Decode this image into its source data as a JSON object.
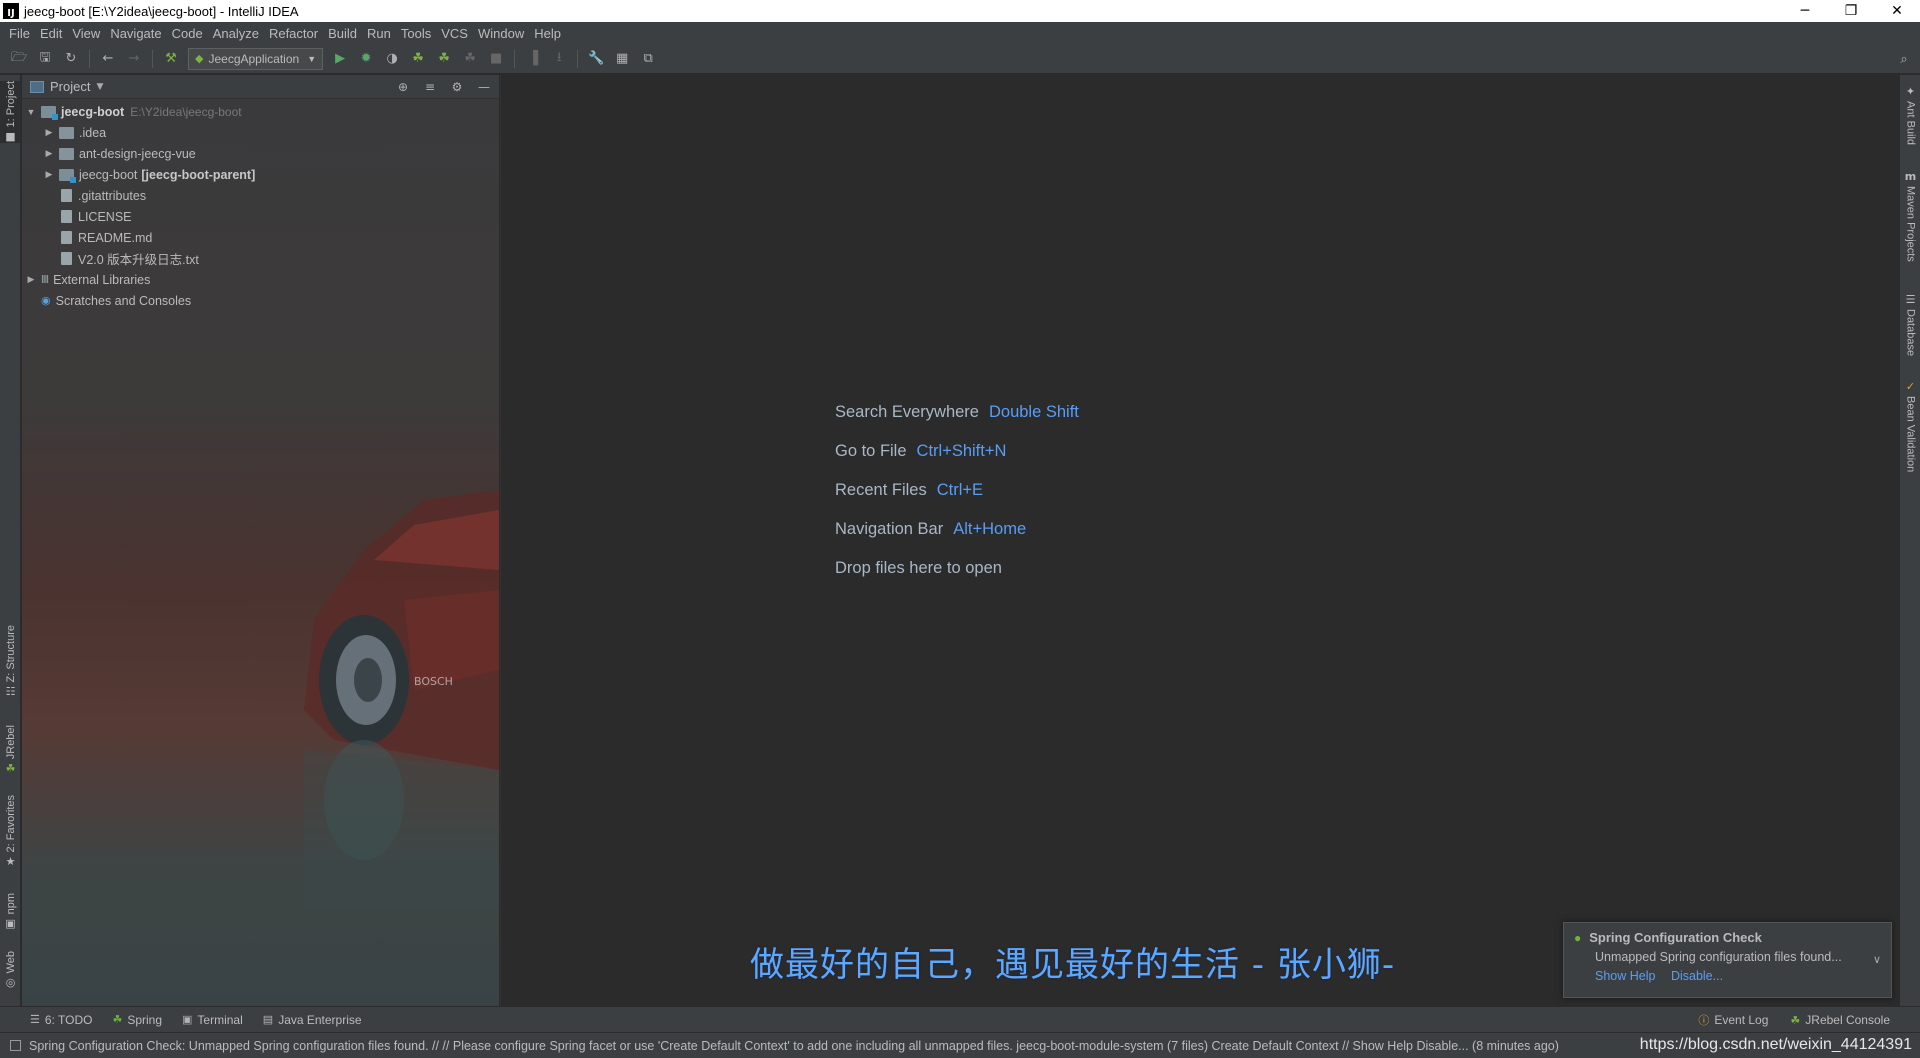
{
  "window": {
    "title": "jeecg-boot [E:\\Y2idea\\jeecg-boot] - IntelliJ IDEA",
    "app_icon_text": "IJ",
    "minimize": "─",
    "restore": "❐",
    "close": "✕"
  },
  "menu": [
    "File",
    "Edit",
    "View",
    "Navigate",
    "Code",
    "Analyze",
    "Refactor",
    "Build",
    "Run",
    "Tools",
    "VCS",
    "Window",
    "Help"
  ],
  "toolbar": {
    "run_config": "JeecgApplication"
  },
  "left_tabs": {
    "project": "1: Project",
    "structure": "Z: Structure",
    "jrebel": "JRebel",
    "favorites": "2: Favorites",
    "npm": "npm",
    "web": "Web"
  },
  "right_tabs": {
    "ant": "Ant Build",
    "maven": "Maven Projects",
    "database": "Database",
    "bean": "Bean Validation"
  },
  "project_panel": {
    "title": "Project",
    "tree": [
      {
        "name": "jeecg-boot",
        "path": "E:\\Y2idea\\jeecg-boot"
      },
      {
        "name": ".idea"
      },
      {
        "name": "ant-design-jeecg-vue"
      },
      {
        "name": "jeecg-boot",
        "module": "[jeecg-boot-parent]"
      },
      {
        "name": ".gitattributes"
      },
      {
        "name": "LICENSE"
      },
      {
        "name": "README.md"
      },
      {
        "name": "V2.0 版本升级日志.txt"
      },
      {
        "name": "External Libraries"
      },
      {
        "name": "Scratches and Consoles"
      }
    ]
  },
  "editor": {
    "hints": [
      {
        "label": "Search Everywhere",
        "key": "Double Shift"
      },
      {
        "label": "Go to File",
        "key": "Ctrl+Shift+N"
      },
      {
        "label": "Recent Files",
        "key": "Ctrl+E"
      },
      {
        "label": "Navigation Bar",
        "key": "Alt+Home"
      },
      {
        "label": "Drop files here to open",
        "key": ""
      }
    ],
    "watermark": "做最好的自己，遇见最好的生活 - 张小狮-"
  },
  "notification": {
    "title": "Spring Configuration Check",
    "text": "Unmapped Spring configuration files found...",
    "link_help": "Show Help",
    "link_disable": "Disable..."
  },
  "bottom_tabs": {
    "todo": "6: TODO",
    "spring": "Spring",
    "terminal": "Terminal",
    "java_ee": "Java Enterprise",
    "event_log": "Event Log",
    "jrebel_console": "JRebel Console"
  },
  "status": {
    "message": "Spring Configuration Check: Unmapped Spring configuration files found. // // Please configure Spring facet or use 'Create Default Context' to add one including all unmapped files. jeecg-boot-module-system (7 files)   Create Default Context // Show Help Disable... (8 minutes ago)",
    "url": "https://blog.csdn.net/weixin_44124391"
  },
  "colors": {
    "link": "#589df6",
    "watermark": "#5aa8ff",
    "spring_green": "#6db33f"
  }
}
